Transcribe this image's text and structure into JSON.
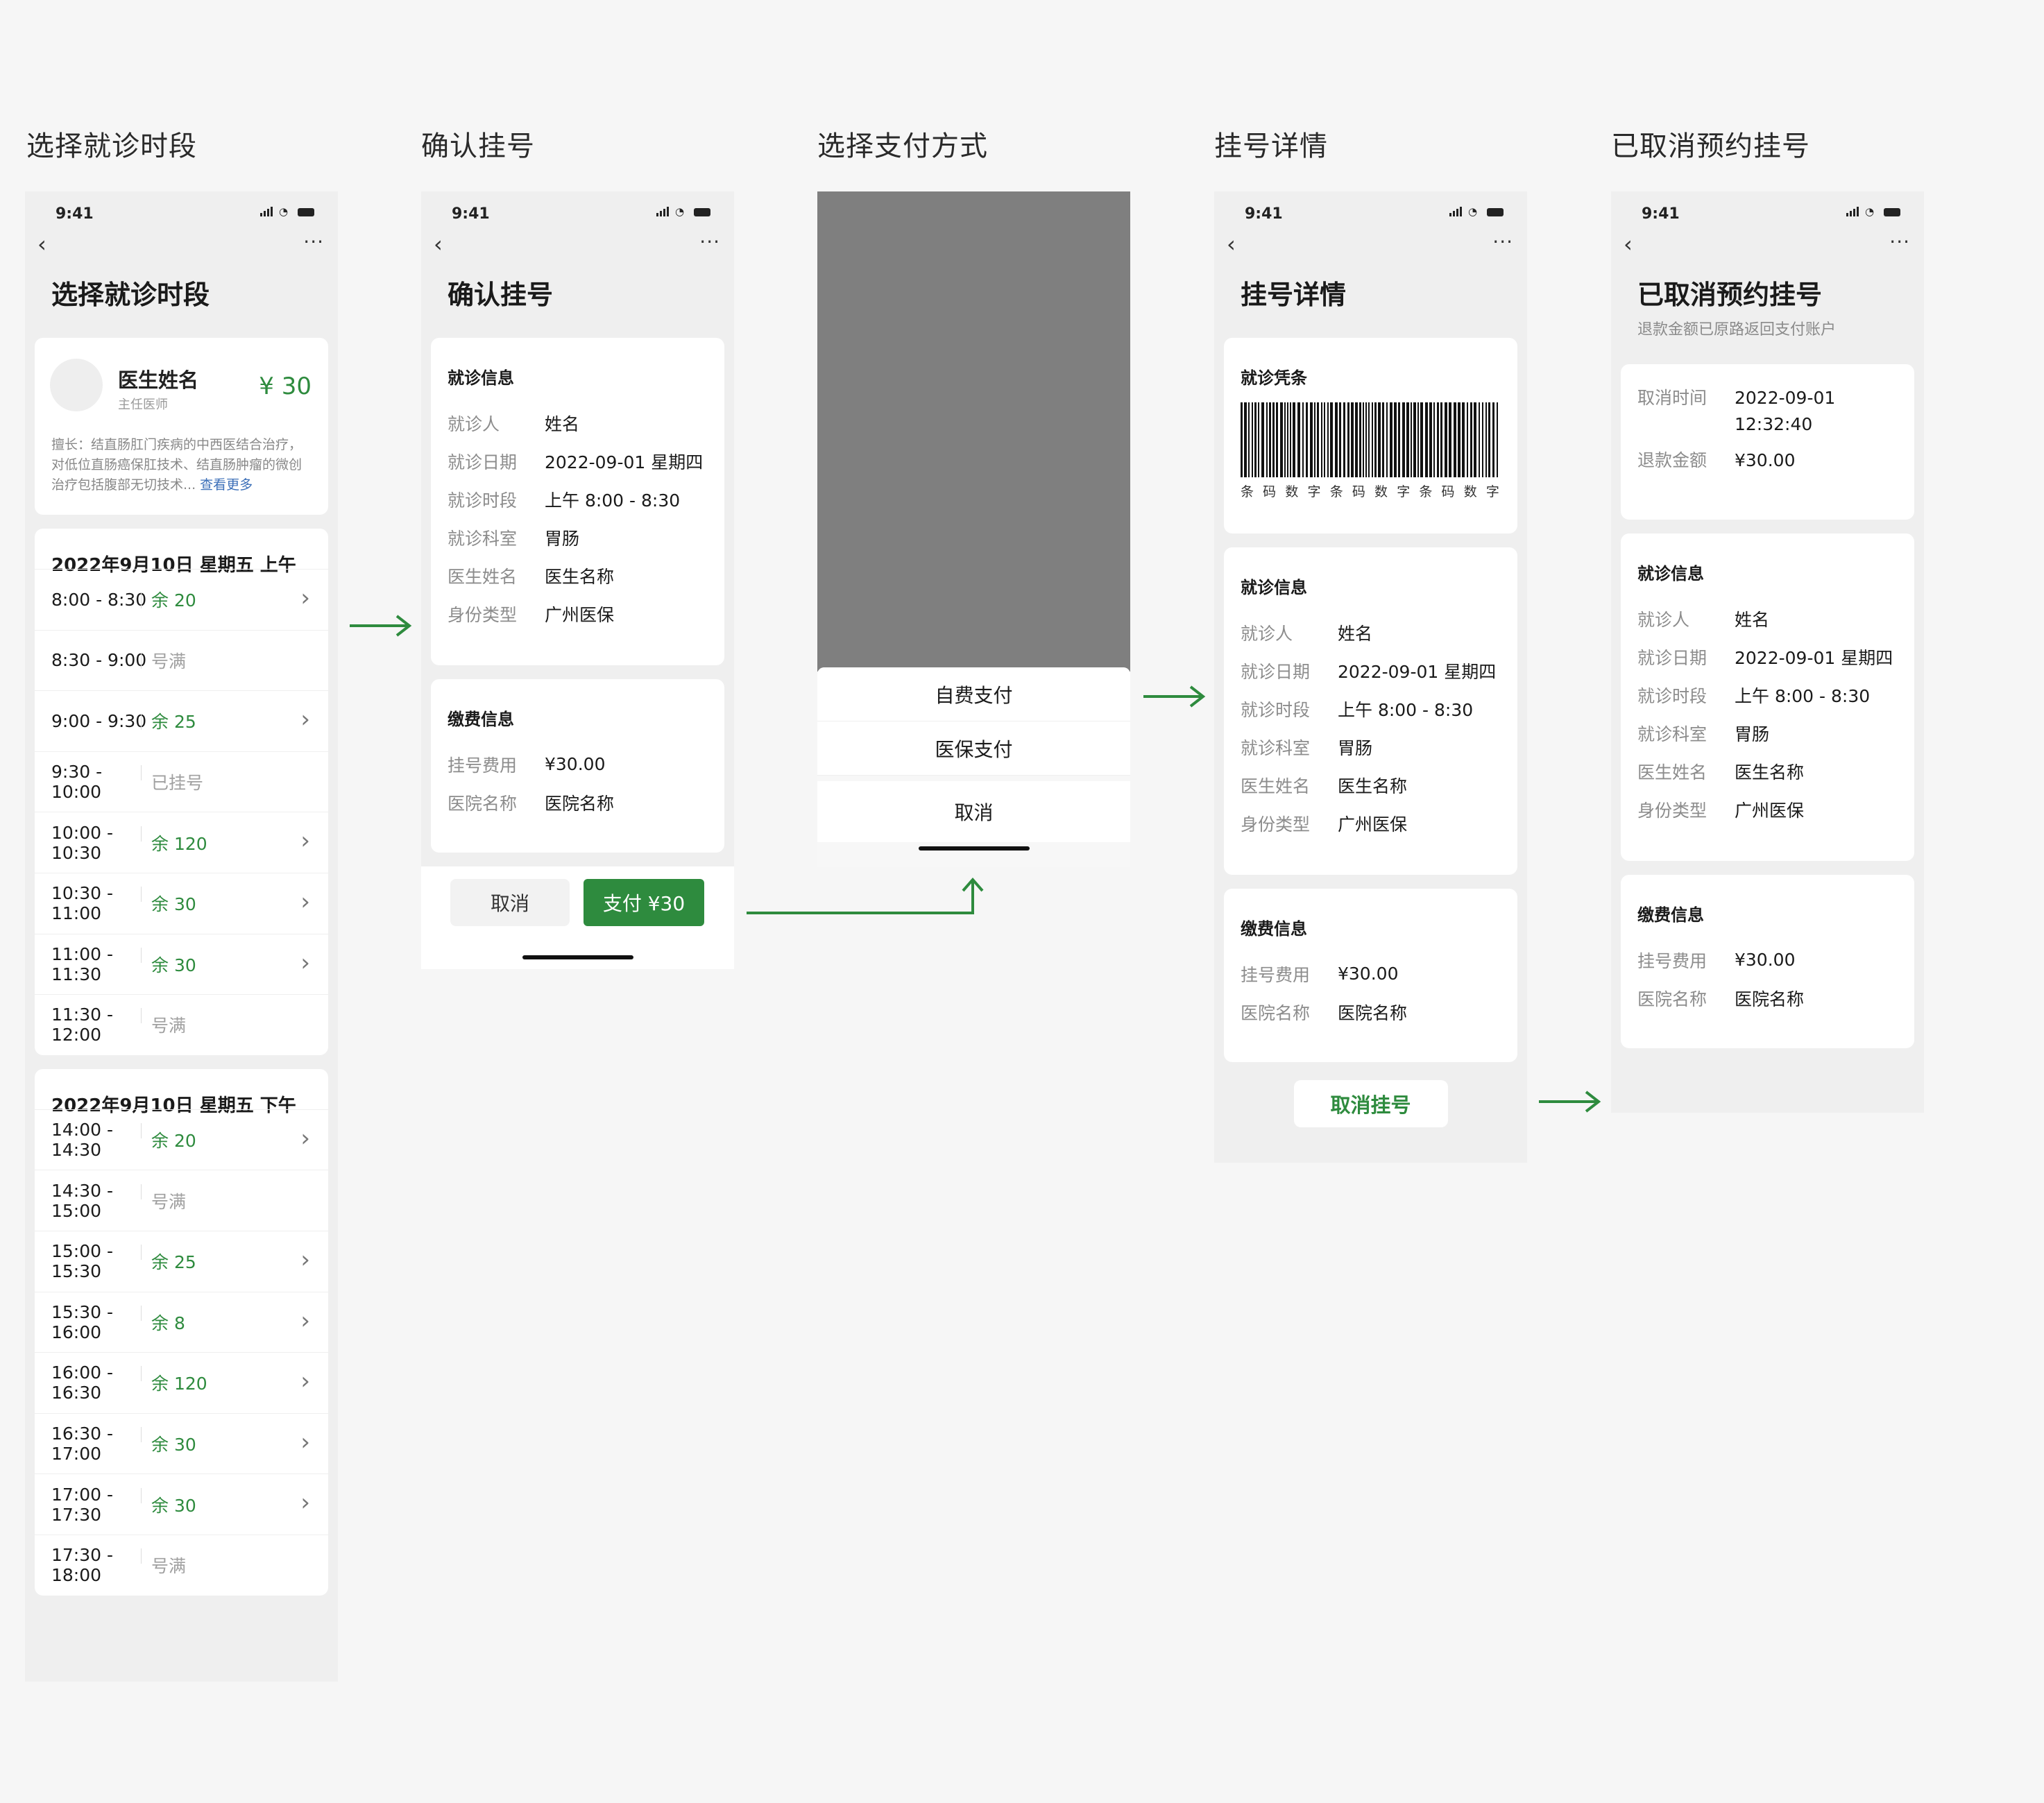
{
  "status_time": "9:41",
  "accent_color": "#2e8b3e",
  "section_titles": [
    "选择就诊时段",
    "确认挂号",
    "选择支付方式",
    "挂号详情",
    "已取消预约挂号"
  ],
  "labels": {
    "patient": "就诊人",
    "date": "就诊日期",
    "period": "就诊时段",
    "dept": "就诊科室",
    "doctor": "医生姓名",
    "id_type": "身份类型",
    "fee": "挂号费用",
    "hospital": "医院名称",
    "cancel_time": "取消时间",
    "refund": "退款金额"
  },
  "visit": {
    "patient": "姓名",
    "date": "2022-09-01 星期四",
    "period": "上午 8:00 - 8:30",
    "dept": "胃肠",
    "doctor": "医生名称",
    "id_type": "广州医保"
  },
  "payment": {
    "fee": "¥30.00",
    "hospital": "医院名称"
  },
  "card_titles": {
    "visit_info": "就诊信息",
    "payment_info": "缴费信息",
    "voucher": "就诊凭条"
  },
  "screen1": {
    "title": "选择就诊时段",
    "doctor_name": "医生姓名",
    "doctor_title": "主任医师",
    "price": "¥ 30",
    "desc": "擅长：结直肠肛门疾病的中西医结合治疗，对低位直肠癌保肛技术、结直肠肿瘤的微创治疗包括腹部无切技术...",
    "more_link": "查看更多",
    "days": [
      {
        "header": "2022年9月10日  星期五  上午",
        "slots": [
          {
            "time": "8:00 - 8:30",
            "state": "余 20",
            "available": true
          },
          {
            "time": "8:30 - 9:00",
            "state": "号满",
            "available": false
          },
          {
            "time": "9:00 - 9:30",
            "state": "余 25",
            "available": true
          },
          {
            "time": "9:30 - 10:00",
            "state": "已挂号",
            "available": false
          },
          {
            "time": "10:00 - 10:30",
            "state": "余 120",
            "available": true
          },
          {
            "time": "10:30 - 11:00",
            "state": "余 30",
            "available": true
          },
          {
            "time": "11:00 - 11:30",
            "state": "余 30",
            "available": true
          },
          {
            "time": "11:30 - 12:00",
            "state": "号满",
            "available": false
          }
        ]
      },
      {
        "header": "2022年9月10日  星期五  下午",
        "slots": [
          {
            "time": "14:00 - 14:30",
            "state": "余 20",
            "available": true
          },
          {
            "time": "14:30 - 15:00",
            "state": "号满",
            "available": false
          },
          {
            "time": "15:00 - 15:30",
            "state": "余 25",
            "available": true
          },
          {
            "time": "15:30 - 16:00",
            "state": "余 8",
            "available": true
          },
          {
            "time": "16:00 - 16:30",
            "state": "余 120",
            "available": true
          },
          {
            "time": "16:30 - 17:00",
            "state": "余 30",
            "available": true
          },
          {
            "time": "17:00 - 17:30",
            "state": "余 30",
            "available": true
          },
          {
            "time": "17:30 - 18:00",
            "state": "号满",
            "available": false
          }
        ]
      }
    ]
  },
  "screen2": {
    "title": "确认挂号",
    "cancel_label": "取消",
    "pay_label": "支付 ¥30"
  },
  "screen3": {
    "options": [
      "自费支付",
      "医保支付"
    ],
    "cancel_label": "取消"
  },
  "screen4": {
    "title": "挂号详情",
    "barcode_text": [
      "条",
      "码",
      "数",
      "字",
      "条",
      "码",
      "数",
      "字",
      "条",
      "码",
      "数",
      "字"
    ],
    "cancel_button": "取消挂号"
  },
  "screen5": {
    "title": "已取消预约挂号",
    "subtitle": "退款金额已原路返回支付账户",
    "cancel_time": "2022-09-01\n12:32:40",
    "refund": "¥30.00"
  }
}
